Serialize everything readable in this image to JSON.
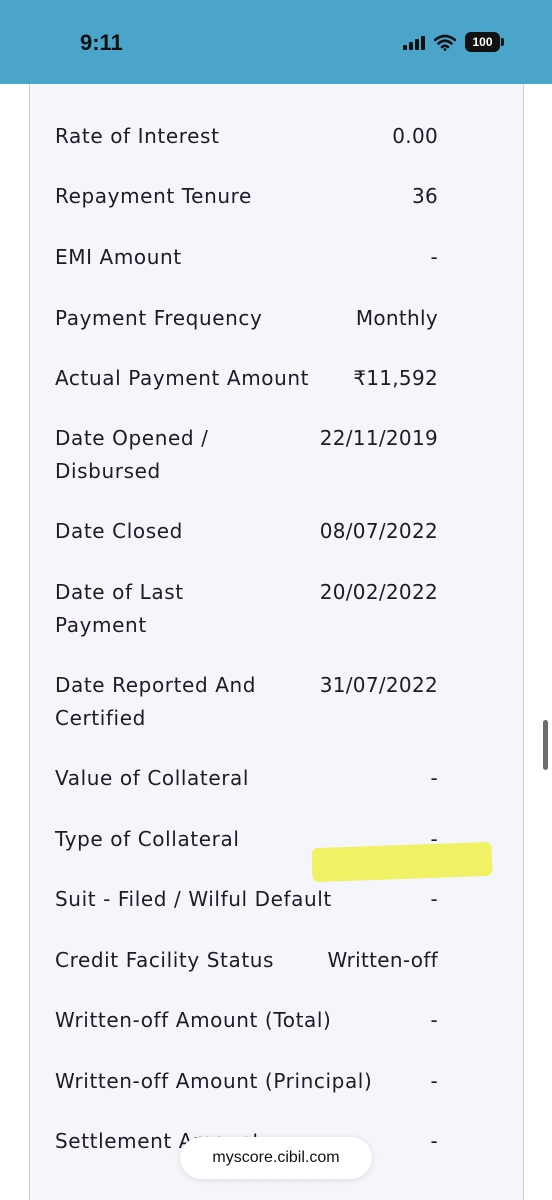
{
  "status_bar": {
    "time": "9:11",
    "battery": "100",
    "icons": [
      "cellular-signal-icon",
      "wifi-icon",
      "battery-icon"
    ]
  },
  "details": [
    {
      "label": "Rate of Interest",
      "value": "0.00"
    },
    {
      "label": "Repayment Tenure",
      "value": "36"
    },
    {
      "label": "EMI Amount",
      "value": "-"
    },
    {
      "label": "Payment Frequency",
      "value": "Monthly"
    },
    {
      "label": "Actual Payment Amount",
      "value": "₹11,592"
    },
    {
      "label": "Date Opened / Disbursed",
      "value": "22/11/2019"
    },
    {
      "label": "Date Closed",
      "value": "08/07/2022"
    },
    {
      "label": "Date of Last Payment",
      "value": "20/02/2022"
    },
    {
      "label": "Date Reported And Certified",
      "value": "31/07/2022"
    },
    {
      "label": "Value of Collateral",
      "value": "-"
    },
    {
      "label": "Type of Collateral",
      "value": "-"
    },
    {
      "label": "Suit - Filed / Wilful Default",
      "value": "-"
    },
    {
      "label": "Credit Facility Status",
      "value": "Written-off"
    },
    {
      "label": "Written-off Amount (Total)",
      "value": "-"
    },
    {
      "label": "Written-off Amount (Principal)",
      "value": "-"
    },
    {
      "label": "Settlement Amount",
      "value": "-"
    }
  ],
  "browser": {
    "url": "myscore.cibil.com"
  },
  "colors": {
    "header": "#4ba4c9",
    "card": "#f4f6fb",
    "highlight": "#f0f04a"
  }
}
